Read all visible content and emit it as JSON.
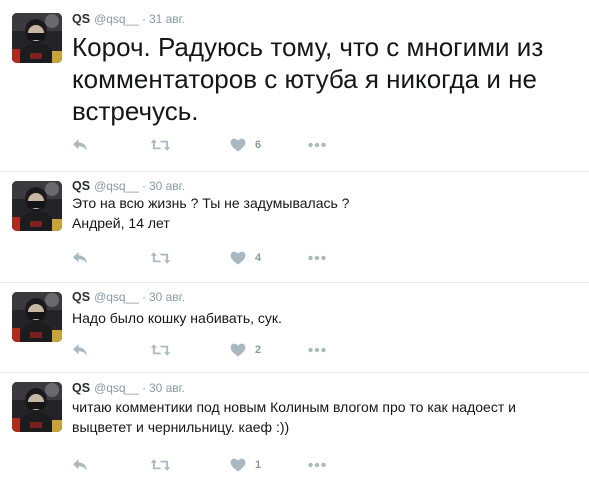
{
  "tweets": [
    {
      "name": "QS",
      "handle": "@qsq__",
      "date": "31 авг.",
      "text": "Короч. Радуюсь тому, что с многими из комментаторов с ютуба я никогда и не встречусь.",
      "likes": "6"
    },
    {
      "name": "QS",
      "handle": "@qsq__",
      "date": "30 авг.",
      "text_line1": "Это на всю жизнь ? Ты не задумывалась ?",
      "text_line2": "Андрей, 14 лет",
      "likes": "4"
    },
    {
      "name": "QS",
      "handle": "@qsq__",
      "date": "30 авг.",
      "text": "Надо было кошку набивать, сук.",
      "likes": "2"
    },
    {
      "name": "QS",
      "handle": "@qsq__",
      "date": "30 авг.",
      "text": "читаю комментики под новым Колиным влогом про то как надоест и выцветет и чернильницу. каеф :))",
      "likes": "1"
    }
  ],
  "separator": "·",
  "icons": {
    "reply": "reply-icon",
    "retweet": "retweet-icon",
    "like": "heart-icon",
    "more": "more-icon"
  },
  "colors": {
    "icon_gray": "#aab8c2",
    "name": "#292f33",
    "meta": "#8899a6",
    "text": "#14171a",
    "divider": "#e6ecf0"
  }
}
